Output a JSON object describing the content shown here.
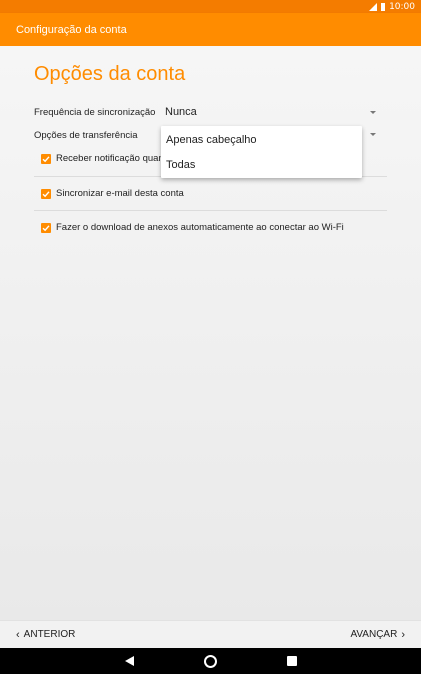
{
  "status_bar": {
    "time": "10:00"
  },
  "app_bar": {
    "title": "Configuração da conta"
  },
  "page": {
    "title": "Opções da conta"
  },
  "settings": {
    "sync_frequency": {
      "label": "Frequência de sincronização",
      "value": "Nunca"
    },
    "transfer_options": {
      "label": "Opções de transferência",
      "value": ""
    }
  },
  "checkboxes": [
    {
      "label": "Receber notificação quan",
      "checked": true
    },
    {
      "label": "Sincronizar e-mail desta conta",
      "checked": true
    },
    {
      "label": "Fazer o download de anexos automaticamente ao conectar ao Wi-Fi",
      "checked": true
    }
  ],
  "dropdown": {
    "options": [
      "Apenas cabeçalho",
      "Todas"
    ]
  },
  "bottom_nav": {
    "back_label": "ANTERIOR",
    "next_label": "AVANÇAR"
  },
  "colors": {
    "accent": "#ff8c00",
    "status_bar": "#f47c00",
    "nav_bar": "#000000"
  },
  "icons": [
    "signal-icon",
    "battery-icon",
    "dropdown-arrow-icon",
    "checkbox-checked-icon",
    "chevron-left-icon",
    "chevron-right-icon",
    "back-icon",
    "home-icon",
    "recents-icon"
  ]
}
